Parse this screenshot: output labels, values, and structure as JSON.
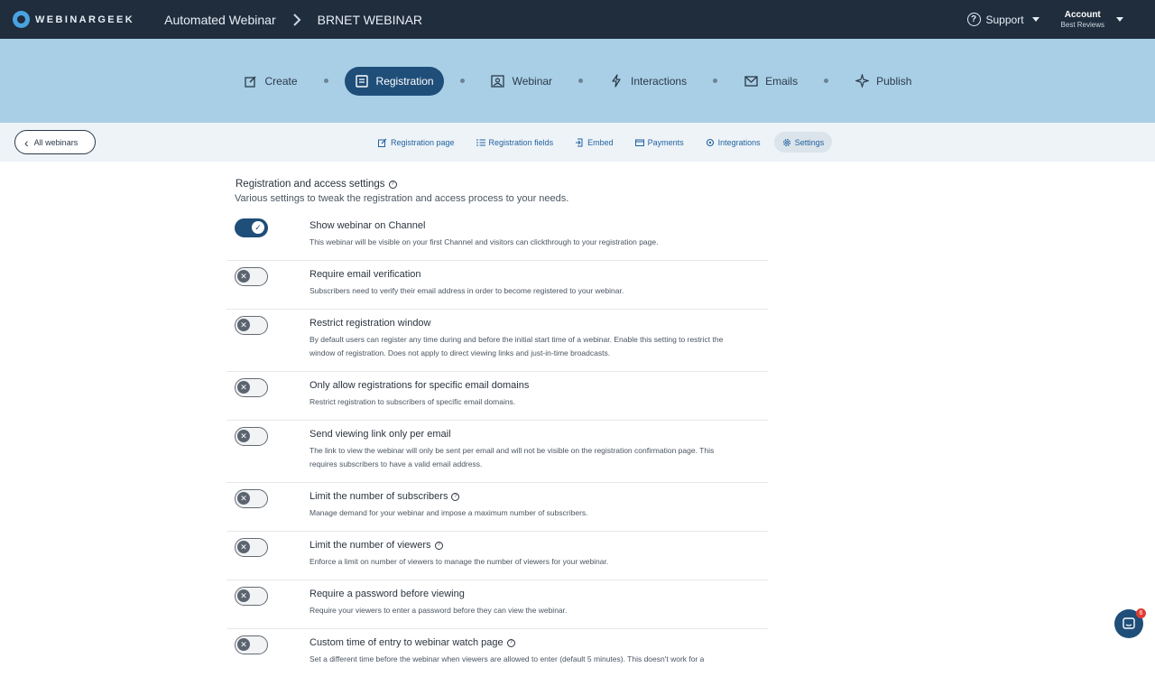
{
  "topbar": {
    "logo_text": "WEBINARGEEK",
    "breadcrumb": [
      "Automated Webinar",
      "BRNET WEBINAR"
    ],
    "support_label": "Support",
    "account_name": "Account",
    "account_sub": "Best Reviews"
  },
  "steps": [
    {
      "label": "Create",
      "icon": "pencil-square-icon"
    },
    {
      "label": "Registration",
      "icon": "form-icon",
      "active": true
    },
    {
      "label": "Webinar",
      "icon": "picture-icon"
    },
    {
      "label": "Interactions",
      "icon": "bolt-icon"
    },
    {
      "label": "Emails",
      "icon": "envelope-icon"
    },
    {
      "label": "Publish",
      "icon": "sparkle-icon"
    }
  ],
  "subnav": {
    "back_label": "All webinars",
    "tabs": [
      {
        "label": "Registration page",
        "icon": "edit-icon"
      },
      {
        "label": "Registration fields",
        "icon": "list-icon"
      },
      {
        "label": "Embed",
        "icon": "embed-icon"
      },
      {
        "label": "Payments",
        "icon": "card-icon"
      },
      {
        "label": "Integrations",
        "icon": "puzzle-icon"
      },
      {
        "label": "Settings",
        "icon": "gear-icon",
        "active": true
      }
    ]
  },
  "section": {
    "title": "Registration and access settings",
    "subtitle": "Various settings to tweak the registration and access process to your needs."
  },
  "settings": [
    {
      "title": "Show webinar on Channel",
      "desc": "This webinar will be visible on your first Channel and visitors can clickthrough to your registration page.",
      "on": true,
      "help": false
    },
    {
      "title": "Require email verification",
      "desc": "Subscribers need to verify their email address in order to become registered to your webinar.",
      "on": false,
      "help": false
    },
    {
      "title": "Restrict registration window",
      "desc": "By default users can register any time during and before the initial start time of a webinar. Enable this setting to restrict the window of registration. Does not apply to direct viewing links and just-in-time broadcasts.",
      "on": false,
      "help": false
    },
    {
      "title": "Only allow registrations for specific email domains",
      "desc": "Restrict registration to subscribers of specific email domains.",
      "on": false,
      "help": false
    },
    {
      "title": "Send viewing link only per email",
      "desc": "The link to view the webinar will only be sent per email and will not be visible on the registration confirmation page. This requires subscribers to have a valid email address.",
      "on": false,
      "help": false
    },
    {
      "title": "Limit the number of subscribers",
      "desc": "Manage demand for your webinar and impose a maximum number of subscribers.",
      "on": false,
      "help": true
    },
    {
      "title": "Limit the number of viewers",
      "desc": "Enforce a limit on number of viewers to manage the number of viewers for your webinar.",
      "on": false,
      "help": true
    },
    {
      "title": "Require a password before viewing",
      "desc": "Require your viewers to enter a password before they can view the webinar.",
      "on": false,
      "help": false
    },
    {
      "title": "Custom time of entry to webinar watch page",
      "desc": "Set a different time before the webinar when viewers are allowed to enter (default 5 minutes). This doesn't work for a",
      "on": false,
      "help": true
    }
  ],
  "chat_badge": "6"
}
